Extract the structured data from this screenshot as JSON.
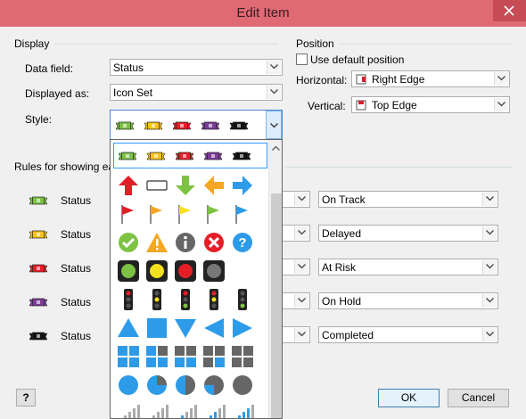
{
  "window": {
    "title": "Edit Item"
  },
  "display": {
    "section_label": "Display",
    "data_field_label": "Data field:",
    "data_field_value": "Status",
    "displayed_as_label": "Displayed as:",
    "displayed_as_value": "Icon Set",
    "style_label": "Style:"
  },
  "position": {
    "section_label": "Position",
    "use_default_label": "Use default position",
    "use_default_checked": false,
    "horizontal_label": "Horizontal:",
    "horizontal_value": "Right Edge",
    "vertical_label": "Vertical:",
    "vertical_value": "Top Edge"
  },
  "rules": {
    "section_label": "Rules for showing ea",
    "rows": [
      {
        "icon": "green-ribbon-icon",
        "color": "#7dc243",
        "field": "Status",
        "value": "On Track"
      },
      {
        "icon": "yellow-ribbon-icon",
        "color": "#f7c21a",
        "field": "Status",
        "value": "Delayed"
      },
      {
        "icon": "red-ribbon-icon",
        "color": "#e41e26",
        "field": "Status",
        "value": "At Risk"
      },
      {
        "icon": "purple-ribbon-icon",
        "color": "#7c3c98",
        "field": "Status",
        "value": "On Hold"
      },
      {
        "icon": "black-ribbon-icon",
        "color": "#111111",
        "field": "Status",
        "value": "Completed"
      }
    ]
  },
  "icon_sets": [
    {
      "name": "ribbons",
      "selected": true
    },
    {
      "name": "arrows"
    },
    {
      "name": "flags"
    },
    {
      "name": "symbols"
    },
    {
      "name": "traffic-lights-round"
    },
    {
      "name": "traffic-lights-rimmed"
    },
    {
      "name": "shapes"
    },
    {
      "name": "quarters-boxes"
    },
    {
      "name": "pies"
    },
    {
      "name": "signal-bars"
    }
  ],
  "buttons": {
    "ok": "OK",
    "cancel": "Cancel",
    "help": "?"
  },
  "colors": {
    "titlebar": "#e06a74",
    "accent_blue": "#3399ff",
    "icon_blue": "#2e9be8",
    "green": "#7dc243",
    "orange": "#f5a623",
    "red": "#e41e26"
  }
}
